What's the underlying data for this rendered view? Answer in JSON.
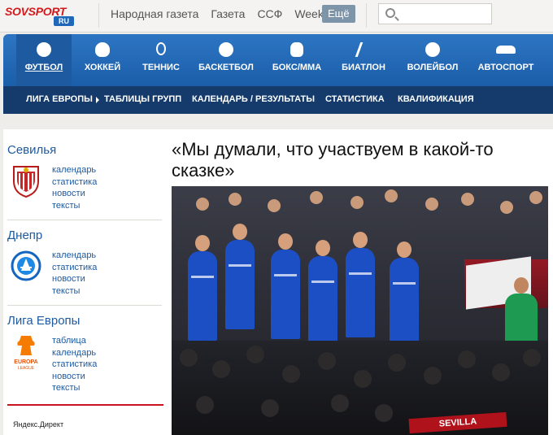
{
  "header": {
    "logo": "SOVSPORT",
    "logo_sub": "RU",
    "links": [
      "Народная газета",
      "Газета",
      "ССФ",
      "Weekly"
    ],
    "more_label": "Ещё",
    "search_placeholder": ""
  },
  "sports_nav": {
    "items": [
      {
        "label": "ФУТБОЛ",
        "icon": "soccer-ball-icon",
        "active": true
      },
      {
        "label": "ХОККЕЙ",
        "icon": "hockey-mask-icon"
      },
      {
        "label": "ТЕННИС",
        "icon": "tennis-racket-icon"
      },
      {
        "label": "БАСКЕТБОЛ",
        "icon": "basketball-icon"
      },
      {
        "label": "БОКС/ММА",
        "icon": "boxing-glove-icon"
      },
      {
        "label": "БИАТЛОН",
        "icon": "skier-icon"
      },
      {
        "label": "ВОЛЕЙБОЛ",
        "icon": "volleyball-icon"
      },
      {
        "label": "АВТОСПОРТ",
        "icon": "car-icon"
      }
    ]
  },
  "sub_nav": {
    "items": [
      "ЛИГА ЕВРОПЫ",
      "ТАБЛИЦЫ ГРУПП",
      "КАЛЕНДАРЬ / РЕЗУЛЬТАТЫ",
      "СТАТИСТИКА",
      "КВАЛИФИКАЦИЯ"
    ]
  },
  "sidebar": {
    "teams": [
      {
        "name": "Севилья",
        "crest": "sevilla-crest-icon",
        "links": [
          "календарь",
          "статистика",
          "новости",
          "тексты"
        ]
      },
      {
        "name": "Днепр",
        "crest": "dnipro-crest-icon",
        "links": [
          "календарь",
          "статистика",
          "новости",
          "тексты"
        ]
      },
      {
        "name": "Лига Европы",
        "crest": "europa-league-logo-icon",
        "crest_text": [
          "EUROPA",
          "LEAGUE"
        ],
        "links": [
          "таблица",
          "календарь",
          "статистика",
          "новости",
          "тексты"
        ]
      }
    ],
    "yandex": "Яндекс.Директ"
  },
  "article": {
    "title": "«Мы думали, что участвуем в какой-то сказке»",
    "photo_scarf_text": "SEVILLA"
  },
  "colors": {
    "brand_red": "#d3191c",
    "nav_blue": "#2d75c3",
    "subnav_dark": "#143b6c",
    "link_blue": "#1d5aa0"
  }
}
